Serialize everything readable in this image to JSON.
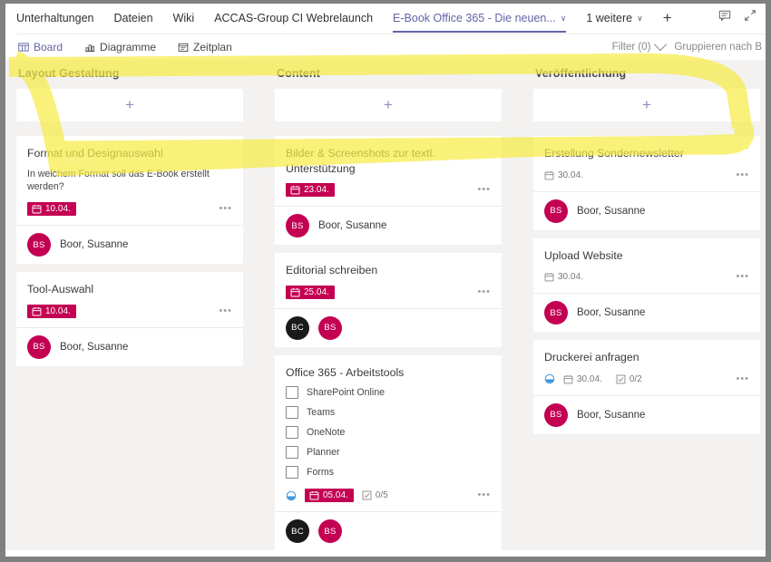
{
  "window": {
    "frame_color": "#808080",
    "background": "#f3f2f1"
  },
  "tabbar": {
    "tabs": [
      {
        "label": "Unterhaltungen",
        "active": false,
        "has_chevron": false
      },
      {
        "label": "Dateien",
        "active": false,
        "has_chevron": false
      },
      {
        "label": "Wiki",
        "active": false,
        "has_chevron": false
      },
      {
        "label": "ACCAS-Group CI Webrelaunch",
        "active": false,
        "has_chevron": false
      },
      {
        "label": "E-Book Office 365 - Die neuen...",
        "active": true,
        "has_chevron": true
      },
      {
        "label": "1 weitere",
        "active": false,
        "has_chevron": true
      }
    ],
    "add_tab_label": "+",
    "chevron_glyph": "∨",
    "right_icons": [
      {
        "name": "chat-icon"
      },
      {
        "name": "expand-icon"
      }
    ]
  },
  "commandbar": {
    "items": [
      {
        "label": "Board",
        "icon": "board-icon",
        "active": true
      },
      {
        "label": "Diagramme",
        "icon": "chart-icon",
        "active": false
      },
      {
        "label": "Zeitplan",
        "icon": "calendar-icon",
        "active": false
      }
    ],
    "filter_label": "Filter (0)",
    "group_label": "Gruppieren nach B"
  },
  "accent": {
    "purple": "#6264a7",
    "crimson": "#c30052",
    "black": "#1b1a19",
    "teal": "#3a96dd"
  },
  "board": {
    "add_card_label": "+",
    "buckets": [
      {
        "title": "Layout Gestaltung",
        "tasks": [
          {
            "title": "Format und Designauswahl",
            "description": "In welchem Format soll das E-Book erstellt werden?",
            "date": "10.04.",
            "date_style": "badge",
            "has_priority_icon": false,
            "checklist_counter": null,
            "checklist": [],
            "ellipsis": "•••",
            "assignees": [
              {
                "initials": "BS",
                "name": "Boor, Susanne",
                "color": "#c30052"
              }
            ]
          },
          {
            "title": "Tool-Auswahl",
            "description": null,
            "date": "10.04.",
            "date_style": "badge",
            "has_priority_icon": false,
            "checklist_counter": null,
            "checklist": [],
            "ellipsis": "•••",
            "assignees": [
              {
                "initials": "BS",
                "name": "Boor, Susanne",
                "color": "#c30052"
              }
            ]
          }
        ]
      },
      {
        "title": "Content",
        "tasks": [
          {
            "title": "Bilder & Screenshots zur textl. Unterstützung",
            "description": null,
            "date": "23.04.",
            "date_style": "badge",
            "has_priority_icon": false,
            "checklist_counter": null,
            "checklist": [],
            "ellipsis": "•••",
            "assignees": [
              {
                "initials": "BS",
                "name": "Boor, Susanne",
                "color": "#c30052"
              }
            ]
          },
          {
            "title": "Editorial schreiben",
            "description": null,
            "date": "25.04.",
            "date_style": "badge",
            "has_priority_icon": false,
            "checklist_counter": null,
            "checklist": [],
            "ellipsis": "•••",
            "assignees": [
              {
                "initials": "BC",
                "name": "",
                "color": "#1b1a19"
              },
              {
                "initials": "BS",
                "name": "",
                "color": "#c30052"
              }
            ]
          },
          {
            "title": "Office 365 - Arbeitstools",
            "description": null,
            "date": "05.04.",
            "date_style": "badge",
            "has_priority_icon": true,
            "checklist_counter": "0/5",
            "checklist": [
              {
                "label": "SharePoint Online",
                "checked": false
              },
              {
                "label": "Teams",
                "checked": false
              },
              {
                "label": "OneNote",
                "checked": false
              },
              {
                "label": "Planner",
                "checked": false
              },
              {
                "label": "Forms",
                "checked": false
              }
            ],
            "ellipsis": "•••",
            "assignees": [
              {
                "initials": "BC",
                "name": "",
                "color": "#1b1a19"
              },
              {
                "initials": "BS",
                "name": "",
                "color": "#c30052"
              }
            ]
          }
        ]
      },
      {
        "title": "Veröffentlichung",
        "tasks": [
          {
            "title": "Erstellung Sondernewsletter",
            "description": null,
            "date": "30.04.",
            "date_style": "plain",
            "has_priority_icon": false,
            "checklist_counter": null,
            "checklist": [],
            "ellipsis": "•••",
            "assignees": [
              {
                "initials": "BS",
                "name": "Boor, Susanne",
                "color": "#c30052"
              }
            ]
          },
          {
            "title": "Upload Website",
            "description": null,
            "date": "30.04.",
            "date_style": "plain",
            "has_priority_icon": false,
            "checklist_counter": null,
            "checklist": [],
            "ellipsis": "•••",
            "assignees": [
              {
                "initials": "BS",
                "name": "Boor, Susanne",
                "color": "#c30052"
              }
            ]
          },
          {
            "title": "Druckerei anfragen",
            "description": null,
            "date": "30.04.",
            "date_style": "plain",
            "has_priority_icon": true,
            "checklist_counter": "0/2",
            "checklist": [],
            "ellipsis": "•••",
            "assignees": [
              {
                "initials": "BS",
                "name": "Boor, Susanne",
                "color": "#c30052"
              }
            ]
          }
        ]
      }
    ]
  },
  "annotation": {
    "highlighter_color": "#f9ed4a",
    "strokes": "yellow-highlighter-marks"
  }
}
